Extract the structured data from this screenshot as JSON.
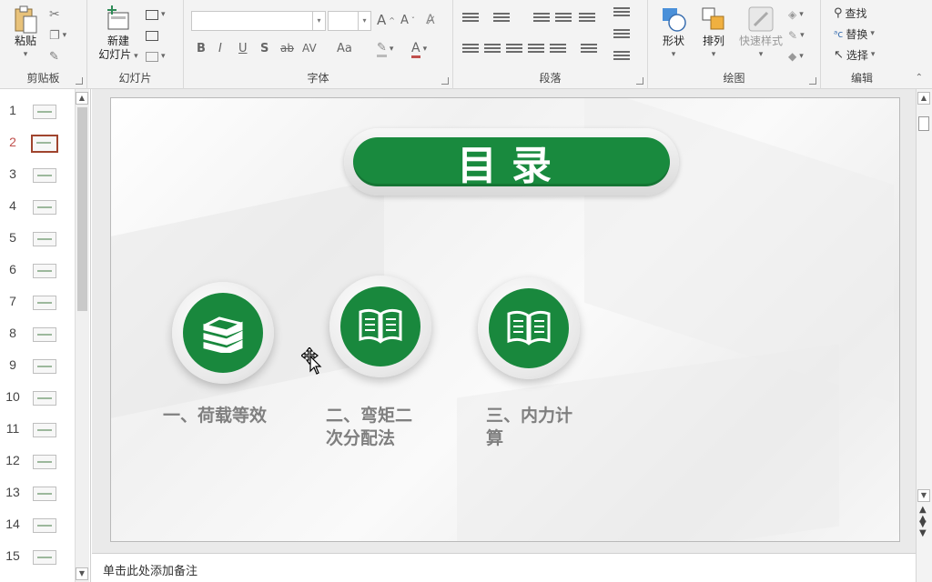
{
  "ribbon": {
    "clipboard": {
      "label": "剪贴板",
      "paste": "粘贴"
    },
    "slides": {
      "label": "幻灯片",
      "new_slide_line1": "新建",
      "new_slide_line2": "幻灯片"
    },
    "font": {
      "label": "字体",
      "font_name": "",
      "font_size": "",
      "bold": "B",
      "italic": "I",
      "underline": "U",
      "shadow": "S",
      "strike": "ab",
      "spacing": "AV",
      "case": "Aa",
      "grow": "A",
      "shrink": "A"
    },
    "paragraph": {
      "label": "段落"
    },
    "drawing": {
      "label": "绘图",
      "shapes": "形状",
      "arrange": "排列",
      "quick_styles": "快速样式"
    },
    "editing": {
      "label": "编辑",
      "find": "查找",
      "replace": "替换",
      "select": "选择"
    }
  },
  "thumbnails": [
    {
      "num": "1"
    },
    {
      "num": "2"
    },
    {
      "num": "3"
    },
    {
      "num": "4"
    },
    {
      "num": "5"
    },
    {
      "num": "6"
    },
    {
      "num": "7"
    },
    {
      "num": "8"
    },
    {
      "num": "9"
    },
    {
      "num": "10"
    },
    {
      "num": "11"
    },
    {
      "num": "12"
    },
    {
      "num": "13"
    },
    {
      "num": "14"
    },
    {
      "num": "15"
    }
  ],
  "active_slide": "2",
  "slide": {
    "title": "目录",
    "items": [
      {
        "label_line1": "一、荷载等效",
        "label_line2": "",
        "icon": "books-stack-icon"
      },
      {
        "label_line1": "二、弯矩二",
        "label_line2": "次分配法",
        "icon": "open-book-icon"
      },
      {
        "label_line1": "三、内力计",
        "label_line2": "算",
        "icon": "open-book-icon"
      }
    ]
  },
  "notes": {
    "placeholder": "单击此处添加备注"
  },
  "colors": {
    "accent_green": "#198a3e",
    "active_thumb": "#a0442e"
  }
}
